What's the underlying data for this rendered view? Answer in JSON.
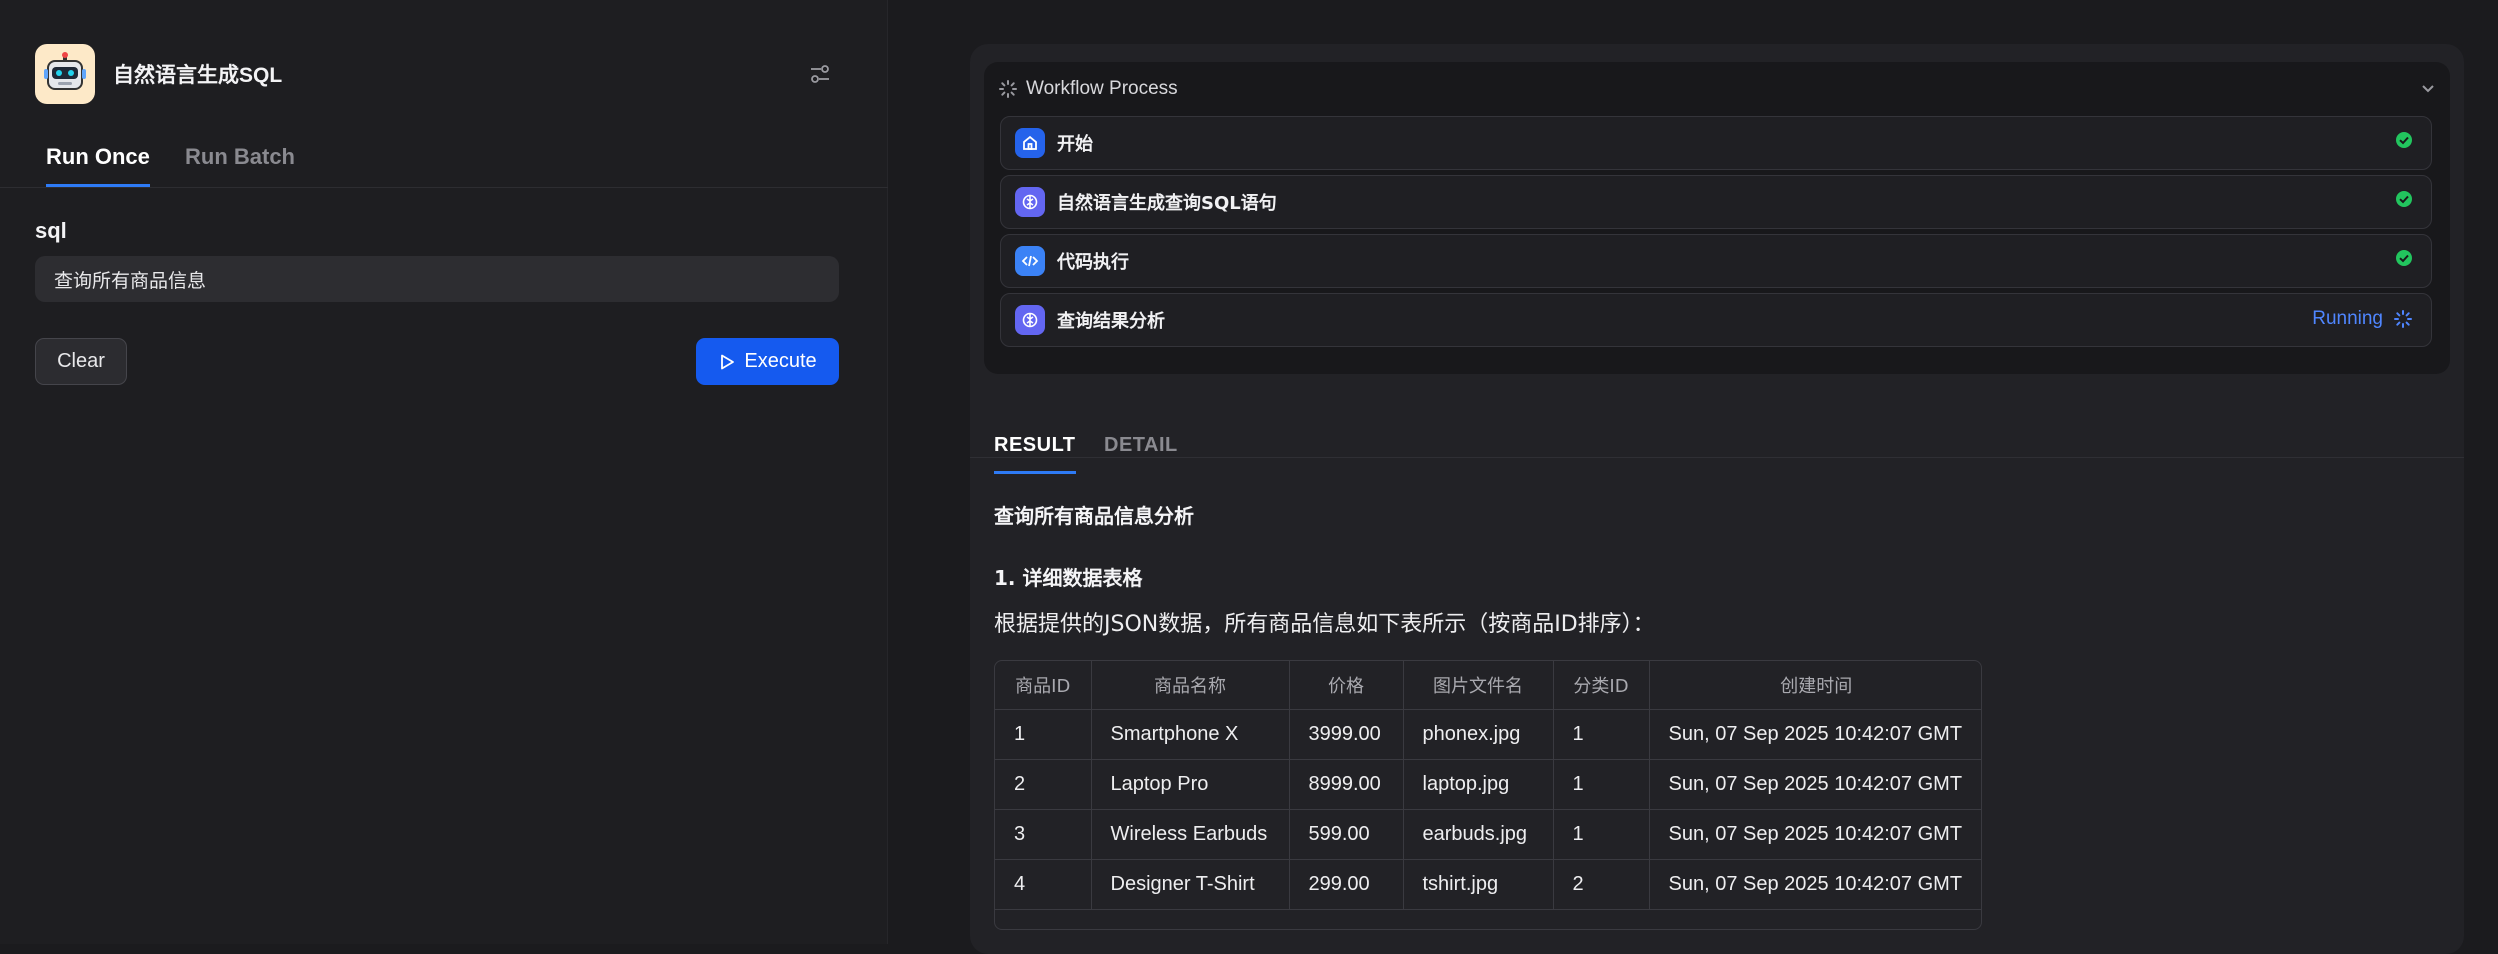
{
  "app": {
    "title": "自然语言生成SQL"
  },
  "tabs": [
    {
      "label": "Run Once",
      "active": true
    },
    {
      "label": "Run Batch",
      "active": false
    }
  ],
  "form": {
    "field_label": "sql",
    "field_value": "查询所有商品信息",
    "clear_label": "Clear",
    "execute_label": "Execute"
  },
  "workflow": {
    "title": "Workflow Process",
    "nodes": [
      {
        "title": "开始",
        "status": "done",
        "icon": "home-icon",
        "color": "#2563eb"
      },
      {
        "title": "自然语言生成查询SQL语句",
        "status": "done",
        "icon": "llm-icon",
        "color": "#6366f1"
      },
      {
        "title": "代码执行",
        "status": "done",
        "icon": "code-icon",
        "color": "#3b82f6"
      },
      {
        "title": "查询结果分析",
        "status": "running",
        "status_label": "Running",
        "icon": "llm-icon",
        "color": "#6366f1"
      }
    ]
  },
  "result_tabs": [
    {
      "label": "RESULT",
      "active": true
    },
    {
      "label": "DETAIL",
      "active": false
    }
  ],
  "result": {
    "title": "查询所有商品信息分析",
    "section": "1. 详细数据表格",
    "paragraph": "根据提供的JSON数据，所有商品信息如下表所示（按商品ID排序）：",
    "columns": [
      "商品ID",
      "商品名称",
      "价格",
      "图片文件名",
      "分类ID",
      "创建时间"
    ],
    "rows": [
      [
        "1",
        "Smartphone X",
        "3999.00",
        "phonex.jpg",
        "1",
        "Sun, 07 Sep 2025 10:42:07 GMT"
      ],
      [
        "2",
        "Laptop Pro",
        "8999.00",
        "laptop.jpg",
        "1",
        "Sun, 07 Sep 2025 10:42:07 GMT"
      ],
      [
        "3",
        "Wireless Earbuds",
        "599.00",
        "earbuds.jpg",
        "1",
        "Sun, 07 Sep 2025 10:42:07 GMT"
      ],
      [
        "4",
        "Designer T-Shirt",
        "299.00",
        "tshirt.jpg",
        "2",
        "Sun, 07 Sep 2025 10:42:07 GMT"
      ]
    ]
  },
  "colors": {
    "accent": "#155aef",
    "success": "#22c55e",
    "running": "#4f86ff"
  }
}
